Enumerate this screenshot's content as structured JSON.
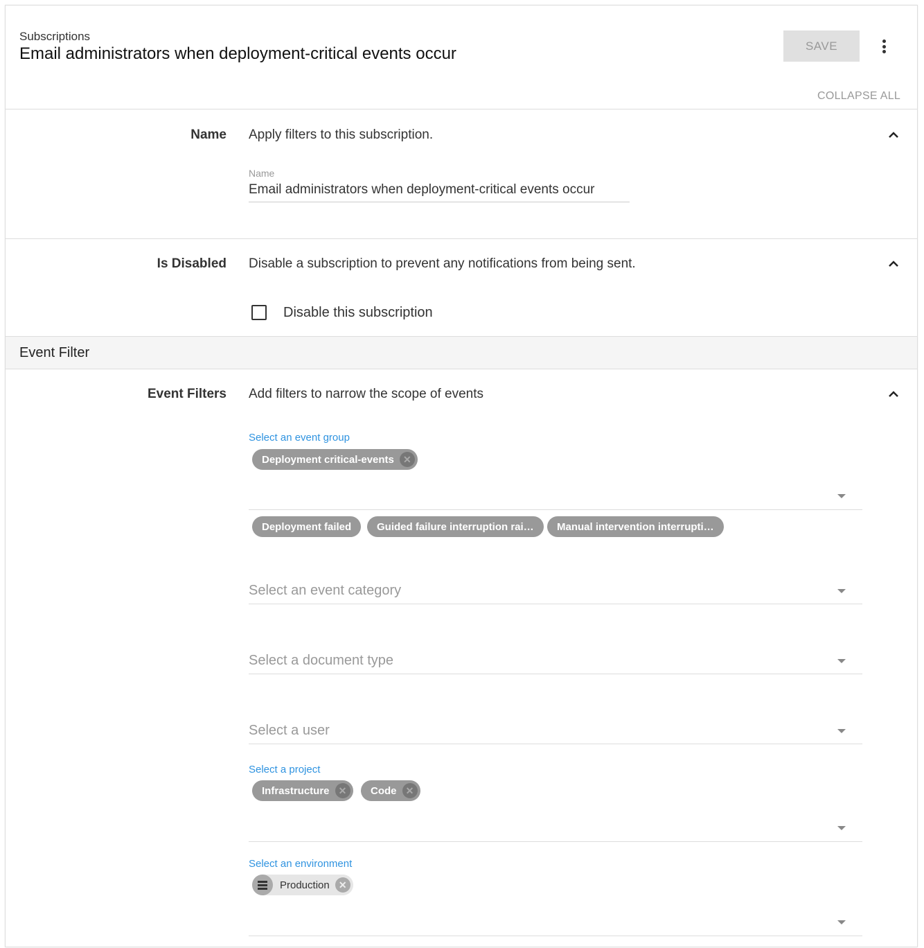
{
  "header": {
    "breadcrumb": "Subscriptions",
    "title": "Email administrators when deployment-critical events occur",
    "save_label": "SAVE",
    "more_icon": "more-vert-icon",
    "collapse_all": "COLLAPSE ALL"
  },
  "name_section": {
    "label": "Name",
    "description": "Apply filters to this subscription.",
    "field_label": "Name",
    "field_value": "Email administrators when deployment-critical events occur"
  },
  "disabled_section": {
    "label": "Is Disabled",
    "description": "Disable a subscription to prevent any notifications from being sent.",
    "checkbox_label": "Disable this subscription",
    "checked": false
  },
  "event_filter_header": "Event Filter",
  "event_filters": {
    "label": "Event Filters",
    "description": "Add filters to narrow the scope of events",
    "event_group": {
      "label": "Select an event group",
      "chips": [
        "Deployment critical-events"
      ]
    },
    "group_events": [
      "Deployment failed",
      "Guided failure interruption rai…",
      "Manual intervention interrupti…"
    ],
    "event_category": {
      "placeholder": "Select an event category"
    },
    "document_type": {
      "placeholder": "Select a document type"
    },
    "user": {
      "placeholder": "Select a user"
    },
    "project": {
      "label": "Select a project",
      "chips": [
        "Infrastructure",
        "Code"
      ]
    },
    "environment": {
      "label": "Select an environment",
      "chips": [
        "Production"
      ]
    }
  },
  "colors": {
    "accent": "#2f93e0",
    "chip": "#999999"
  }
}
